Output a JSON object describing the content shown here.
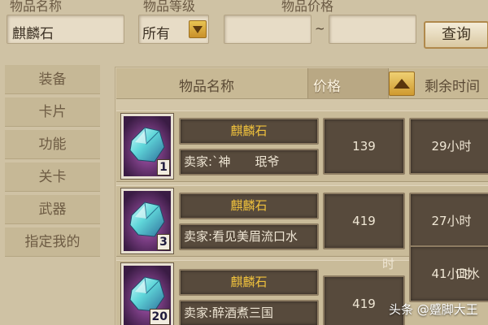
{
  "search": {
    "name_label": "物品名称",
    "level_label": "物品等级",
    "price_label": "物品价格",
    "name_value": "麒麟石",
    "level_value": "所有",
    "price_separator": "~",
    "search_button": "查询"
  },
  "categories": [
    "装备",
    "卡片",
    "功能",
    "关卡",
    "武器",
    "指定我的"
  ],
  "table_header": {
    "name": "物品名称",
    "price": "价格",
    "time": "剩余时间"
  },
  "listings": [
    {
      "name": "麒麟石",
      "seller": "卖家:`神　　珉爷",
      "quantity": "1",
      "price": "139",
      "time": "29小时"
    },
    {
      "name": "麒麟石",
      "seller": "卖家:看见美眉流口水",
      "quantity": "3",
      "price": "419",
      "time": "27小时"
    },
    {
      "name": "麒麟石",
      "seller": "卖家:醉酒煮三国",
      "quantity": "20",
      "price": "419",
      "time": "41小时"
    }
  ],
  "overlay_fragments": {
    "fragment_a": "时",
    "fragment_b": "口水"
  },
  "watermark": "头条 @蹙脚大王",
  "colors": {
    "background": "#cfc2a4",
    "cell_dark": "#574a3c",
    "item_name_gold": "#f0c23c",
    "sort_arrow": "#e0b040"
  },
  "icons": {
    "item": "crystal-gem-icon",
    "level_dropdown": "triangle-down-icon",
    "sort": "triangle-up-icon"
  }
}
